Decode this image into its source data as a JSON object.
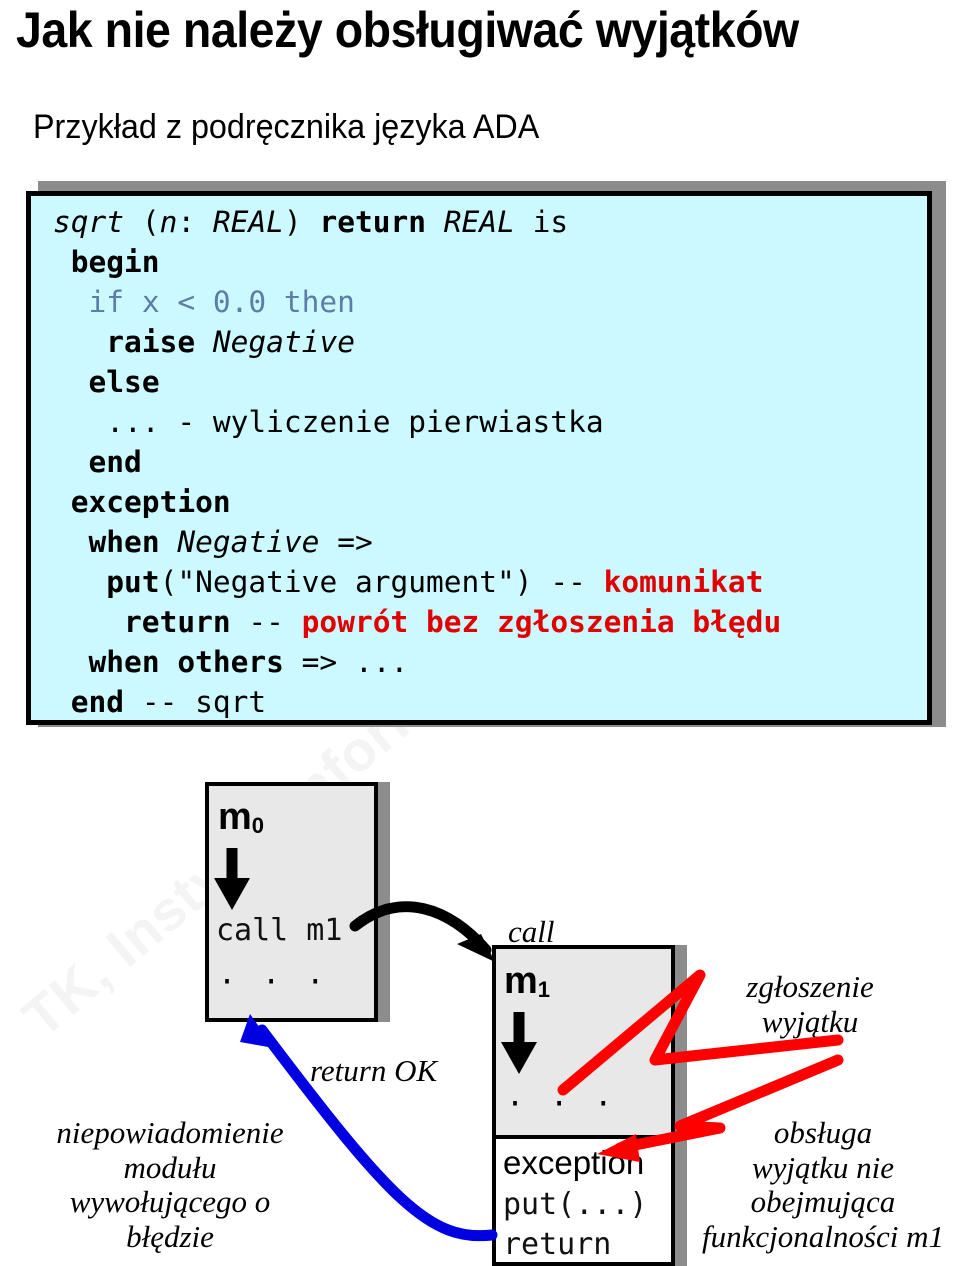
{
  "slide": {
    "title": "Jak nie należy obsługiwać wyjątków",
    "subtitle": "Przykład z podręcznika języka ADA",
    "watermark": "TK, Instytut Informatyki"
  },
  "code_block": {
    "background_color": "#ccf9ff",
    "border_color": "#000000",
    "shadow_color": "#8c8c8c",
    "keyword_blue": "#5b7da8",
    "comment_red": "#e00000",
    "lines": [
      {
        "id": "line-signature",
        "segments": [
          {
            "text": "sqrt ",
            "style": "italic"
          },
          {
            "text": "(",
            "style": "plain"
          },
          {
            "text": "n",
            "style": "italic"
          },
          {
            "text": ": ",
            "style": "plain"
          },
          {
            "text": "REAL",
            "style": "italic"
          },
          {
            "text": ") ",
            "style": "plain"
          },
          {
            "text": "return ",
            "style": "bold"
          },
          {
            "text": "REAL",
            "style": "italic"
          },
          {
            "text": " is",
            "style": "plain"
          }
        ]
      },
      {
        "id": "line-begin",
        "segments": [
          {
            "text": " ",
            "style": "plain"
          },
          {
            "text": "begin",
            "style": "bold"
          }
        ]
      },
      {
        "id": "line-if",
        "segments": [
          {
            "text": "  ",
            "style": "plain"
          },
          {
            "text": "if x < 0.0 then",
            "style": "blue"
          }
        ]
      },
      {
        "id": "line-raise",
        "segments": [
          {
            "text": "   ",
            "style": "plain"
          },
          {
            "text": "raise ",
            "style": "bold"
          },
          {
            "text": "Negative",
            "style": "italic"
          }
        ]
      },
      {
        "id": "line-else",
        "segments": [
          {
            "text": "  ",
            "style": "plain"
          },
          {
            "text": "else",
            "style": "bold"
          }
        ]
      },
      {
        "id": "line-comment-wyliczenie",
        "segments": [
          {
            "text": "   ... - wyliczenie pierwiastka",
            "style": "plain"
          }
        ]
      },
      {
        "id": "line-end-if",
        "segments": [
          {
            "text": "  ",
            "style": "plain"
          },
          {
            "text": "end",
            "style": "bold"
          }
        ]
      },
      {
        "id": "line-exception",
        "segments": [
          {
            "text": " ",
            "style": "plain"
          },
          {
            "text": "exception",
            "style": "bold"
          }
        ]
      },
      {
        "id": "line-when-negative",
        "segments": [
          {
            "text": "  ",
            "style": "plain"
          },
          {
            "text": "when ",
            "style": "bold"
          },
          {
            "text": "Negative",
            "style": "italic"
          },
          {
            "text": " =>",
            "style": "plain"
          }
        ]
      },
      {
        "id": "line-put",
        "segments": [
          {
            "text": "   ",
            "style": "plain"
          },
          {
            "text": "put",
            "style": "bold"
          },
          {
            "text": "(\"Negative argument\") -- ",
            "style": "plain"
          },
          {
            "text": "komunikat",
            "style": "red"
          }
        ]
      },
      {
        "id": "line-return",
        "segments": [
          {
            "text": "    ",
            "style": "plain"
          },
          {
            "text": "return",
            "style": "bold"
          },
          {
            "text": " -- ",
            "style": "plain"
          },
          {
            "text": "powrót bez zgłoszenia błędu",
            "style": "red"
          }
        ]
      },
      {
        "id": "line-when-others",
        "segments": [
          {
            "text": "  ",
            "style": "plain"
          },
          {
            "text": "when others",
            "style": "bold"
          },
          {
            "text": " => ...",
            "style": "plain"
          }
        ]
      },
      {
        "id": "line-end-sqrt",
        "segments": [
          {
            "text": " ",
            "style": "plain"
          },
          {
            "text": "end",
            "style": "bold"
          },
          {
            "text": " -- sqrt",
            "style": "plain"
          }
        ]
      }
    ]
  },
  "diagram": {
    "module_m0": {
      "label": "m",
      "subscript": "0",
      "body_line": "call m1",
      "dots": "· · ·",
      "fill_color": "#e8e8e8"
    },
    "module_m1": {
      "label": "m",
      "subscript": "1",
      "dots": "· · ·",
      "exception_heading": "exception",
      "exception_line_put": "put(...)",
      "exception_line_return": "return",
      "fill_color": "#e8e8e8",
      "exception_fill_color": "#ffffff"
    },
    "labels": {
      "call": "call",
      "return_ok": "return OK",
      "zgloszenie_wyjatku": [
        "zgłoszenie",
        "wyjątku"
      ],
      "niepowiadomienie": [
        "niepowiadomienie",
        "modułu",
        "wywołującego o",
        "błędzie"
      ],
      "obsluga": [
        "obsługa",
        "wyjątku nie",
        "obejmująca",
        "funkcjonalności m1"
      ]
    },
    "arrow_colors": {
      "call_arrow": "#000000",
      "return_arrow": "#0000e0",
      "exception_arrow": "#ff0000"
    }
  }
}
